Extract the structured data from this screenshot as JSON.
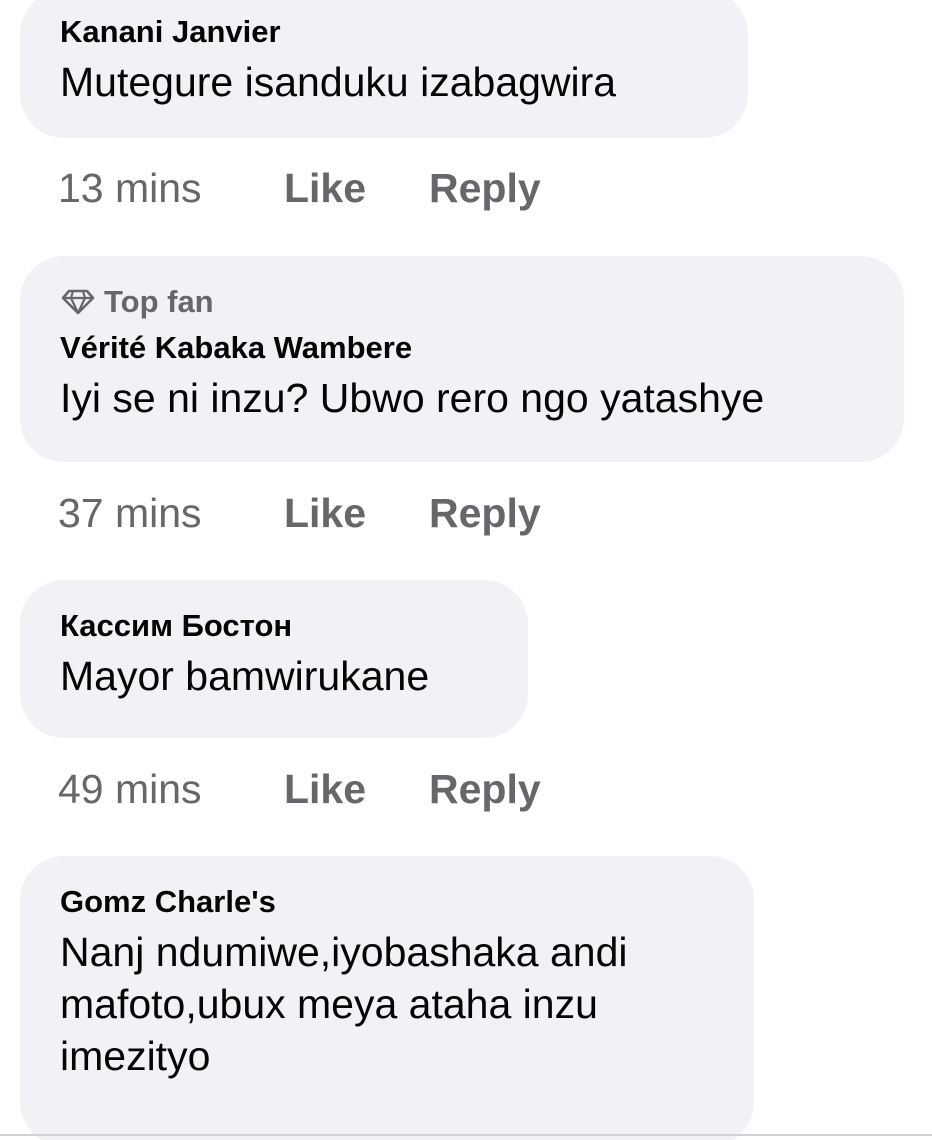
{
  "comments": [
    {
      "author": "Kanani Janvier",
      "text": "Mutegure isanduku izabagwira",
      "time": "13 mins",
      "like": "Like",
      "reply": "Reply"
    },
    {
      "badge": "Top fan",
      "badge_icon": "diamond-icon",
      "author": "Vérité Kabaka Wambere",
      "text": "Iyi se ni inzu? Ubwo rero ngo yatashye",
      "time": "37 mins",
      "like": "Like",
      "reply": "Reply"
    },
    {
      "author": "Кассим Бостон",
      "text": "Mayor bamwirukane",
      "time": "49 mins",
      "like": "Like",
      "reply": "Reply"
    },
    {
      "author": "Gomz Charle's",
      "text": "Nanj ndumiwe,iyobashaka andi mafoto,ubux meya ataha inzu imezityo"
    }
  ],
  "colors": {
    "bubble_bg": "#f0f2f5",
    "text": "#050505",
    "secondary_text": "#65676b"
  }
}
